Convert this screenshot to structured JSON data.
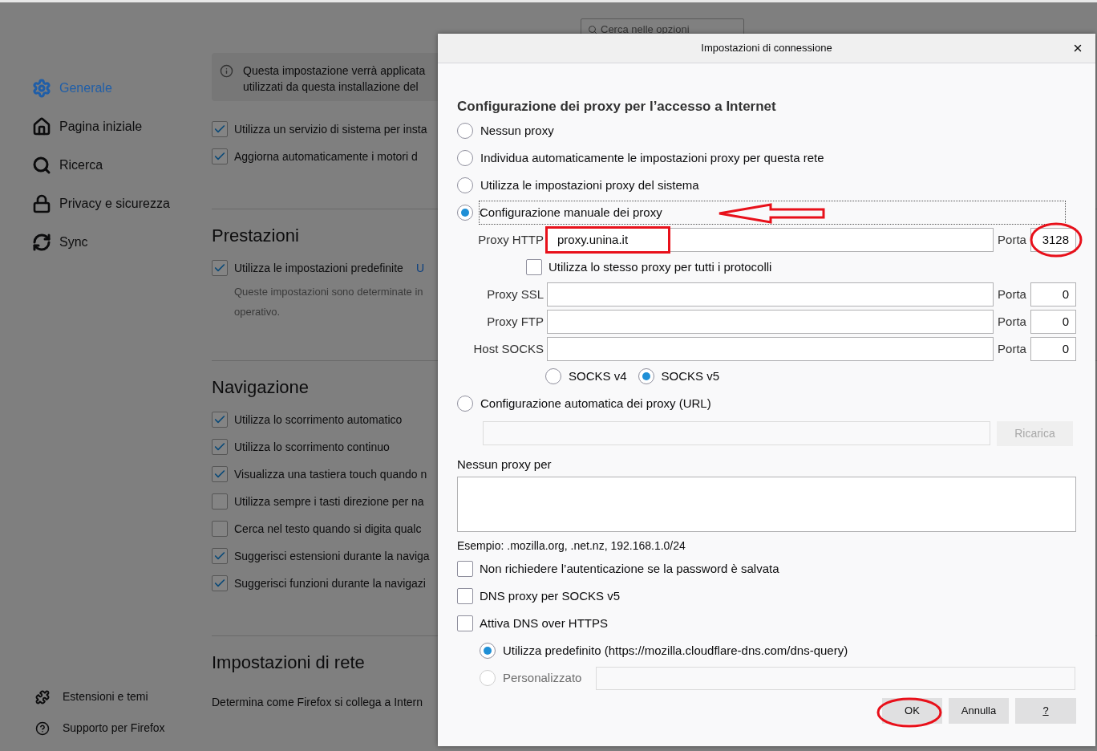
{
  "search": {
    "placeholder": "Cerca nelle opzioni"
  },
  "sidebar": {
    "items": [
      {
        "kind": "gear",
        "label": "Generale",
        "selected": true
      },
      {
        "kind": "home",
        "label": "Pagina iniziale",
        "selected": false
      },
      {
        "kind": "search",
        "label": "Ricerca",
        "selected": false
      },
      {
        "kind": "lock",
        "label": "Privacy e sicurezza",
        "selected": false
      },
      {
        "kind": "sync",
        "label": "Sync",
        "selected": false
      }
    ],
    "footer_items": [
      {
        "kind": "puzzle",
        "label": "Estensioni e temi"
      },
      {
        "kind": "help",
        "label": "Supporto per Firefox"
      }
    ]
  },
  "general": {
    "notice": [
      "Questa impostazione verrà applicata",
      "utilizzati da questa installazione del"
    ],
    "checkboxes": [
      {
        "label": "Utilizza un servizio di sistema per insta",
        "checked": true
      },
      {
        "label": "Aggiorna automaticamente i motori d",
        "checked": true
      }
    ]
  },
  "sections": [
    {
      "title": "Prestazioni",
      "checkboxes": [
        {
          "label": "Utilizza le impostazioni predefinite",
          "checked": true,
          "link": "U"
        }
      ],
      "note": [
        "Queste impostazioni sono determinate in",
        "operativo."
      ]
    },
    {
      "title": "Navigazione",
      "checkboxes": [
        {
          "label": "Utilizza lo scorrimento automatico",
          "checked": true
        },
        {
          "label": "Utilizza lo scorrimento continuo",
          "checked": true
        },
        {
          "label": "Visualizza una tastiera touch quando n",
          "checked": true
        },
        {
          "label": "Utilizza sempre i tasti direzione per na",
          "checked": false
        },
        {
          "label": "Cerca nel testo quando si digita qualc",
          "checked": false
        },
        {
          "label": "Suggerisci estensioni durante la naviga",
          "checked": true
        },
        {
          "label": "Suggerisci funzioni durante la navigazi",
          "checked": true
        }
      ]
    },
    {
      "title": "Impostazioni di rete",
      "text": "Determina come Firefox si collega a Intern"
    }
  ],
  "dialog": {
    "title": "Impostazioni di connessione",
    "heading": "Configurazione dei proxy per l’accesso a Internet",
    "proxy_modes": [
      {
        "label": "Nessun proxy",
        "selected": false
      },
      {
        "label": "Individua automaticamente le impostazioni proxy per questa rete",
        "selected": false
      },
      {
        "label": "Utilizza le impostazioni proxy del sistema",
        "selected": false
      },
      {
        "label": "Configurazione manuale dei proxy",
        "selected": true
      }
    ],
    "http": {
      "label": "Proxy HTTP",
      "value": "proxy.unina.it",
      "port_label": "Porta",
      "port": "3128"
    },
    "same_proxy": {
      "label": "Utilizza lo stesso proxy per tutti i protocolli",
      "checked": false
    },
    "proxies": [
      {
        "label": "Proxy SSL",
        "port_label": "Porta",
        "port": "0"
      },
      {
        "label": "Proxy FTP",
        "port_label": "Porta",
        "port": "0"
      },
      {
        "label": "Host SOCKS",
        "port_label": "Porta",
        "port": "0"
      }
    ],
    "socks_versions": [
      {
        "label": "SOCKS v4",
        "selected": false
      },
      {
        "label": "SOCKS v5",
        "selected": true
      }
    ],
    "auto_config": {
      "label": "Configurazione automatica dei proxy (URL)",
      "selected": false,
      "reload_button": "Ricarica",
      "disabled": true
    },
    "no_proxy": {
      "label": "Nessun proxy per",
      "example": "Esempio: .mozilla.org, .net.nz, 192.168.1.0/24"
    },
    "checkboxes": [
      {
        "label": "Non richiedere l’autenticazione se la password è salvata",
        "checked": false
      },
      {
        "label": "DNS proxy per SOCKS v5",
        "checked": false
      },
      {
        "label": "Attiva DNS over HTTPS",
        "checked": false
      }
    ],
    "doh": [
      {
        "label": "Utilizza predefinito (https://mozilla.cloudflare-dns.com/dns-query)",
        "selected": true,
        "disabled": false
      },
      {
        "label": "Personalizzato",
        "selected": false,
        "disabled": true
      }
    ],
    "buttons": [
      "OK",
      "Annulla",
      "?"
    ]
  }
}
